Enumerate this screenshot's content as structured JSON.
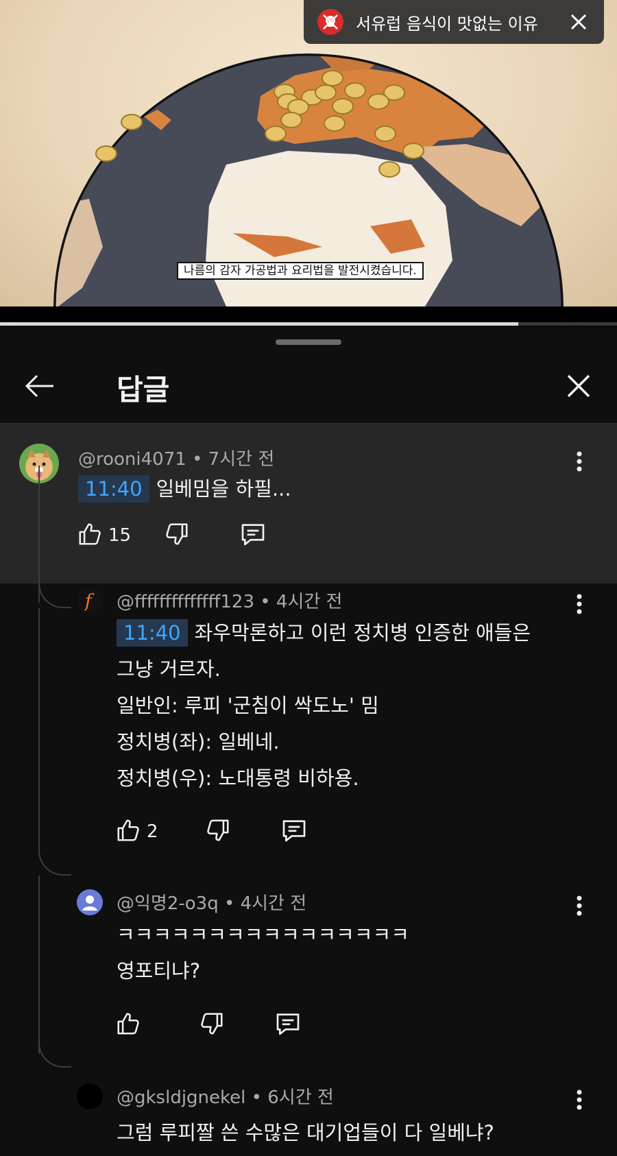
{
  "video": {
    "caption": "나름의 감자 가공법과 요리법을 발전시켰습니다.",
    "progress_fraction": 0.84
  },
  "notification": {
    "icon": "skull-icon",
    "title": "서유럽 음식이 맛없는 이유",
    "close_icon": "close-icon"
  },
  "panel": {
    "title": "답글",
    "back_icon": "back-arrow-icon",
    "close_icon": "close-icon"
  },
  "parent_comment": {
    "handle": "@rooni4071",
    "time": "• 7시간 전",
    "timestamp": "11:40",
    "text": "일베밈을 하필...",
    "likes": "15"
  },
  "replies": [
    {
      "handle": "@ffffffffffffff123",
      "time": "• 4시간 전",
      "timestamp": "11:40",
      "lines": [
        "좌우막론하고 이런 정치병 인증한 애들은",
        "그냥 거르자.",
        "일반인: 루피 '군침이 싹도노' 밈",
        "정치병(좌): 일베네.",
        "정치병(우): 노대통령 비하용."
      ],
      "likes": "2"
    },
    {
      "handle": "@익명2-o3q",
      "time": "• 4시간 전",
      "lines": [
        "ㅋㅋㅋㅋㅋㅋㅋㅋㅋㅋㅋㅋㅋㅋㅋㅋ",
        "영포티냐?"
      ],
      "likes": ""
    },
    {
      "handle": "@gksldjgnekel",
      "time": "• 6시간 전",
      "lines": [
        "그럼 루피짤 쓴 수많은 대기업들이 다 일베냐?"
      ]
    }
  ],
  "colors": {
    "timestamp_text": "#3ea6ff",
    "timestamp_bg": "#263850",
    "panel_bg": "#0f0f0f",
    "parent_bg": "#272727",
    "meta_text": "#aaaaaa"
  }
}
